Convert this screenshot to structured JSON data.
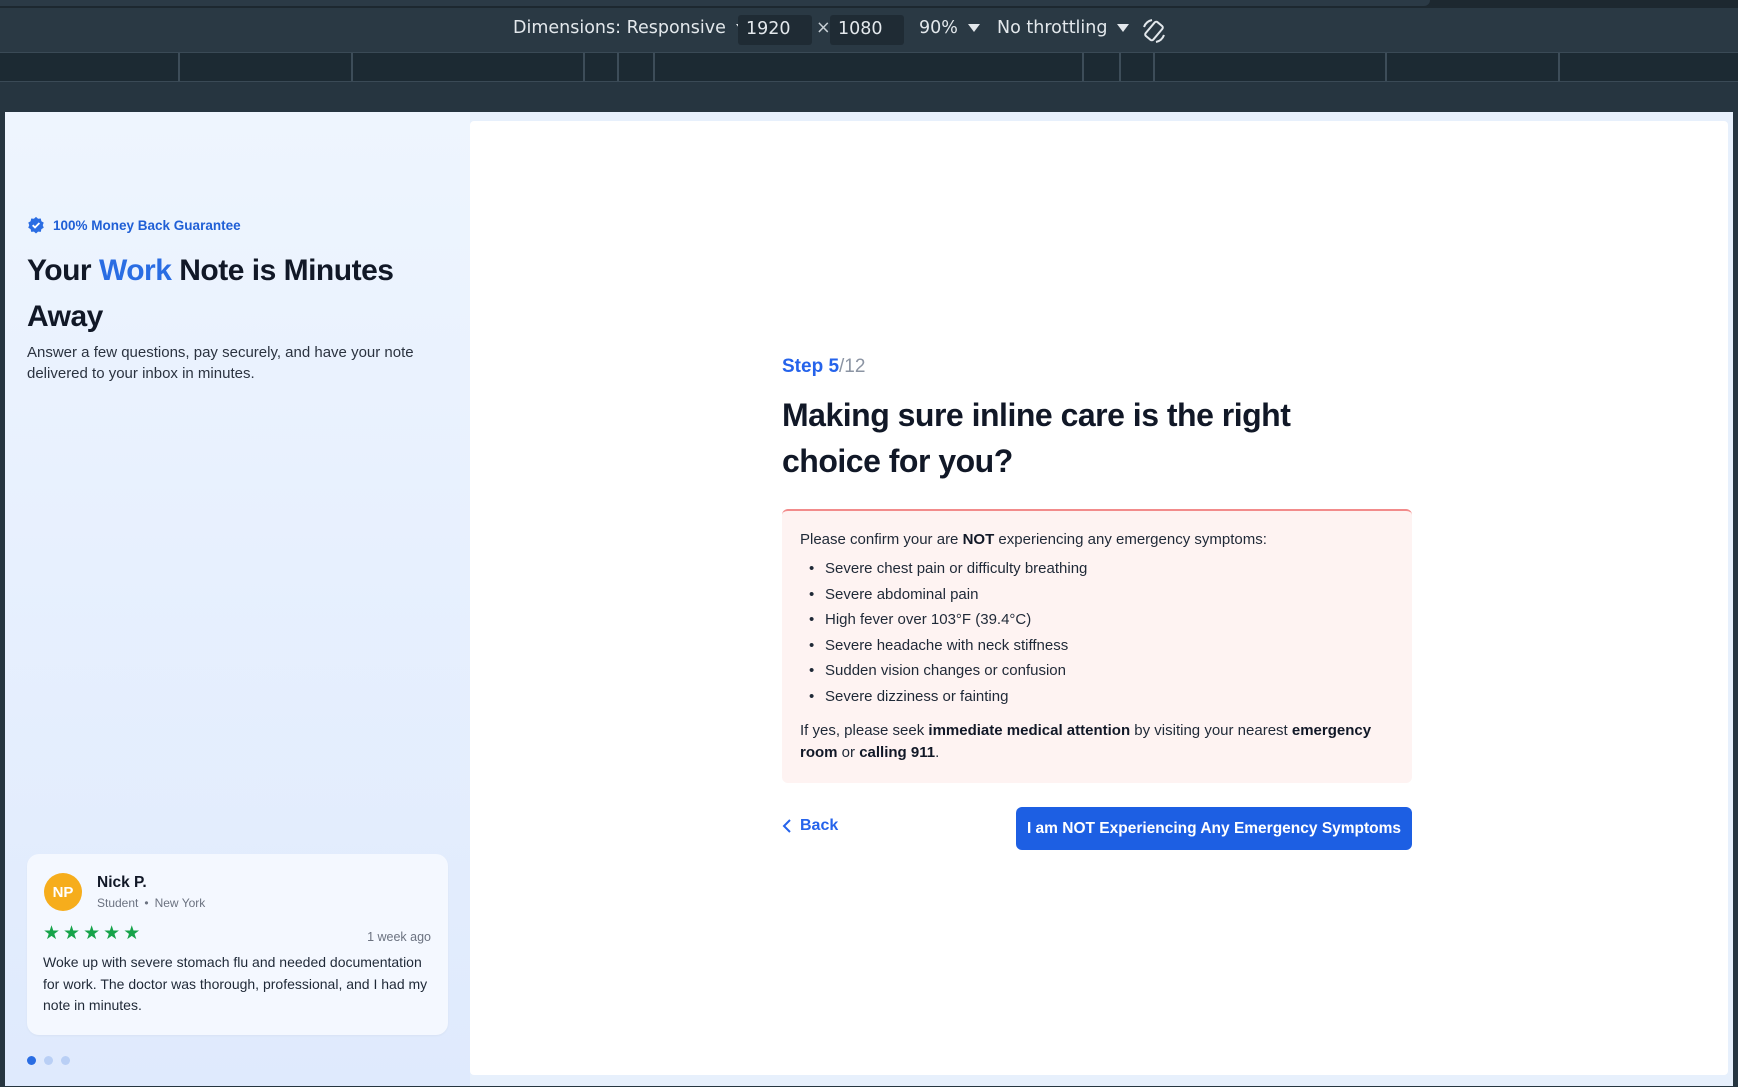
{
  "devtools": {
    "dimensions_label": "Dimensions: Responsive",
    "width": "1920",
    "times": "×",
    "height": "1080",
    "zoom": "90%",
    "throttling": "No throttling"
  },
  "left": {
    "guarantee": "100% Money Back Guarantee",
    "title_part1": "Your ",
    "title_accent": "Work",
    "title_part2": " Note is Minutes Away",
    "subtitle": "Answer a few questions, pay securely, and have your note delivered to your inbox in minutes."
  },
  "review": {
    "initials": "NP",
    "name": "Nick P.",
    "role": "Student",
    "separator": "•",
    "location": "New York",
    "rating": 5,
    "time": "1 week ago",
    "text": "Woke up with severe stomach flu and needed documentation for work. The doctor was thorough, professional, and I had my note in minutes.",
    "carousel_total": 3,
    "carousel_active": 1
  },
  "step": {
    "label": "Step ",
    "current": "5",
    "total": "/12",
    "question": "Making sure inline care is the right choice for you?"
  },
  "alert": {
    "intro_pre": "Please confirm your are ",
    "intro_bold": "NOT",
    "intro_post": " experiencing any emergency symptoms:",
    "symptoms": [
      "Severe chest pain or difficulty breathing",
      "Severe abdominal pain",
      "High fever over 103°F (39.4°C)",
      "Severe headache with neck stiffness",
      "Sudden vision changes or confusion",
      "Severe dizziness or fainting"
    ],
    "foot_1": "If yes, please seek ",
    "foot_b1": "immediate medical attention",
    "foot_2": " by visiting your nearest ",
    "foot_b2": "emergency room",
    "foot_3": " or ",
    "foot_b3": "calling 911",
    "foot_4": "."
  },
  "actions": {
    "back_label": "Back",
    "confirm_label": "I am NOT Experiencing Any Emergency Symptoms"
  },
  "colors": {
    "accent": "#2563eb",
    "button": "#1d5fe3",
    "star": "#16a34a",
    "avatar": "#f6ad1c",
    "alert_bg": "#fef3f2",
    "alert_border": "#f28b8b"
  }
}
